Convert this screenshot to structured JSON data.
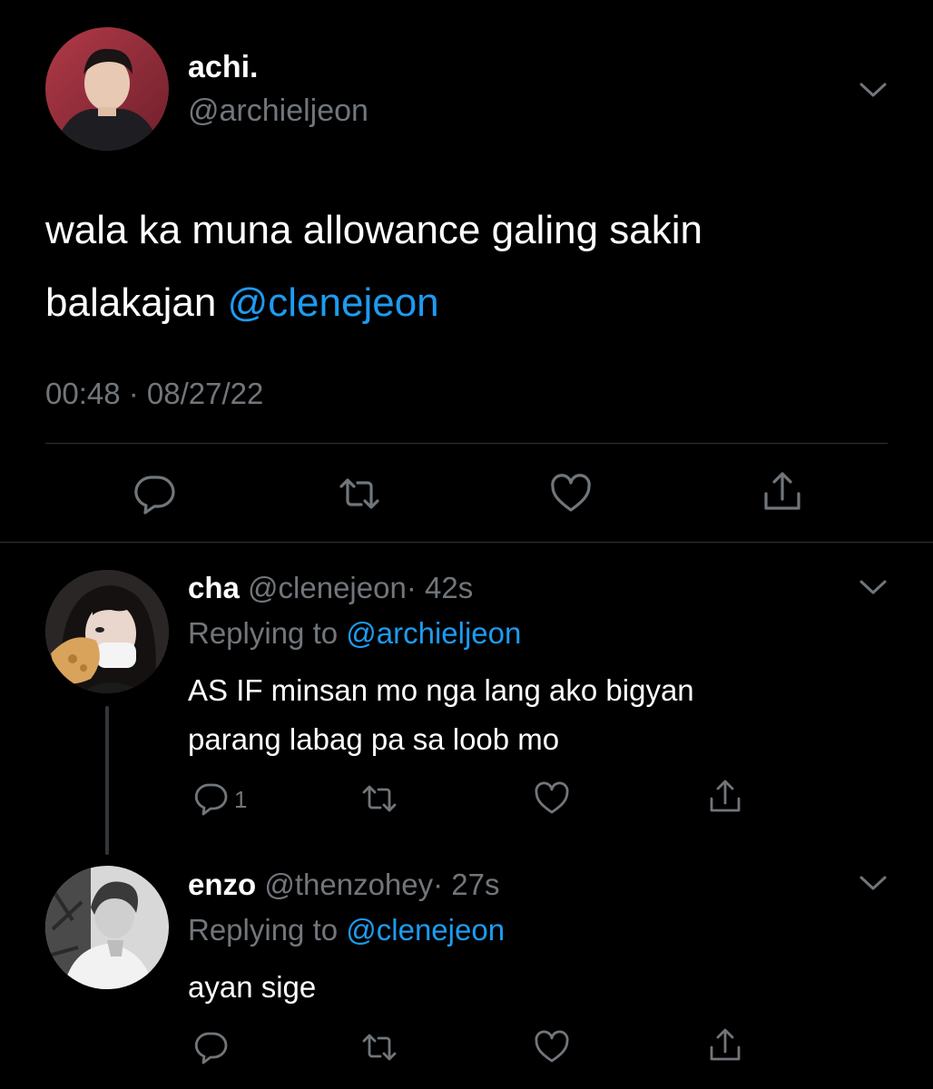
{
  "main_tweet": {
    "display_name": "achi.",
    "handle": "@archieljeon",
    "text_line1": "wala ka muna allowance galing sakin",
    "text_line2_prefix": "balakajan ",
    "mention": "@clenejeon",
    "timestamp": "00:48 · 08/27/22",
    "actions": [
      "comment-icon",
      "retweet-icon",
      "like-icon",
      "share-icon"
    ]
  },
  "replies": [
    {
      "display_name": "cha",
      "handle": "@clenejeon",
      "age": "· 42s",
      "replying_prefix": "Replying to ",
      "replying_to": "@archieljeon",
      "text_line1": "AS IF minsan mo nga lang ako bigyan",
      "text_line2": "parang labag pa sa loob mo",
      "reply_count": "1"
    },
    {
      "display_name": "enzo",
      "handle": "@thenzohey",
      "age": "· 27s",
      "replying_prefix": "Replying to ",
      "replying_to": "@clenejeon",
      "text_line1": "ayan sige"
    }
  ],
  "colors": {
    "background": "#000000",
    "text": "#ffffff",
    "secondary": "#71767b",
    "accent": "#1d9bf0",
    "divider": "#2f3336"
  }
}
